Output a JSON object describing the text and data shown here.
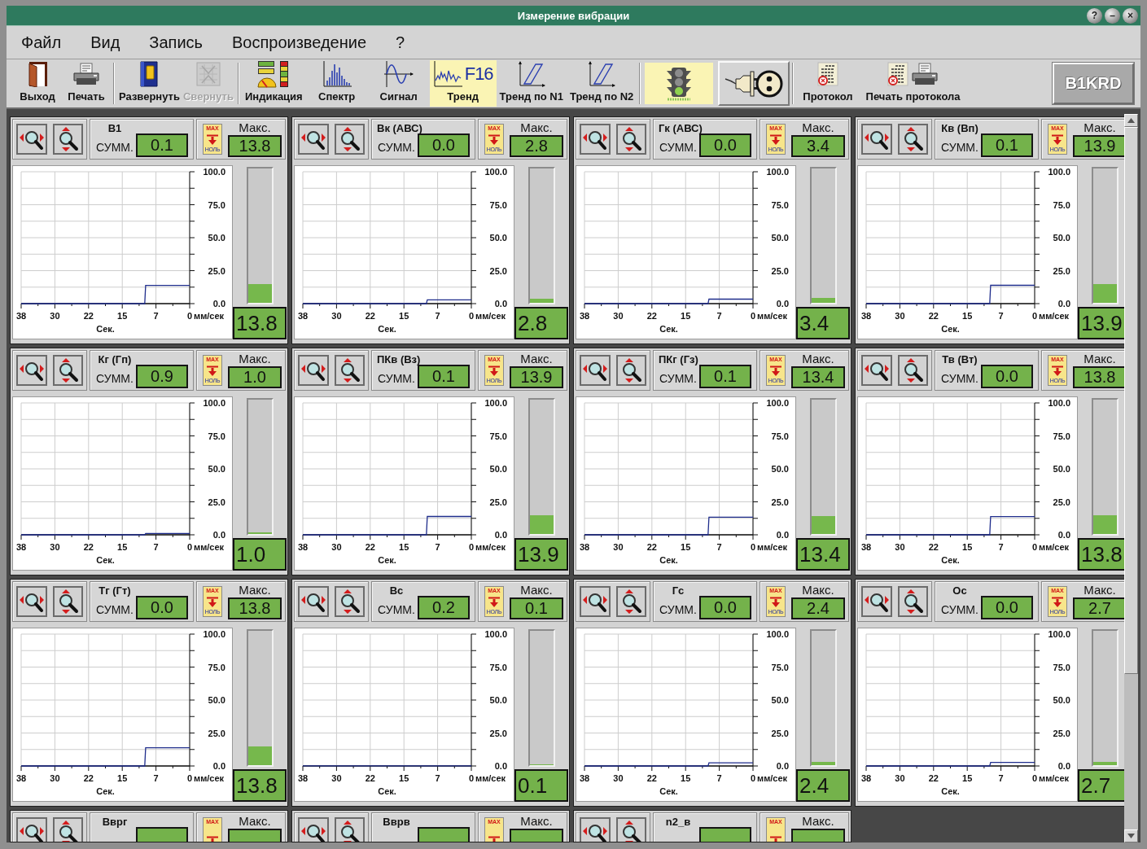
{
  "window": {
    "title": "Измерение вибрации",
    "controls": [
      "?",
      "–",
      "×"
    ]
  },
  "menu": [
    "Файл",
    "Вид",
    "Запись",
    "Воспроизведение",
    "?"
  ],
  "toolbar": {
    "groups": [
      {
        "buttons": [
          {
            "kind": "tool",
            "label": "Выход",
            "selected": false,
            "disabled": false
          },
          {
            "kind": "tool",
            "label": "Печать",
            "selected": false,
            "disabled": false
          }
        ]
      },
      {
        "buttons": [
          {
            "kind": "tool",
            "label": "Развернуть",
            "selected": false,
            "disabled": false
          },
          {
            "kind": "tool",
            "label": "Свернуть",
            "selected": false,
            "disabled": true
          }
        ]
      },
      {
        "buttons": [
          {
            "kind": "tool",
            "label": "Индикация",
            "selected": false,
            "disabled": false
          },
          {
            "kind": "tool",
            "label": "Спектр",
            "selected": false,
            "disabled": false
          },
          {
            "kind": "tool",
            "label": "Сигнал",
            "selected": false,
            "disabled": false
          },
          {
            "kind": "tool",
            "label": "Тренд",
            "badge": "F16",
            "selected": true,
            "disabled": false
          },
          {
            "kind": "tool",
            "label": "Тренд по N1",
            "selected": false,
            "disabled": false
          },
          {
            "kind": "tool",
            "label": "Тренд по N2",
            "selected": false,
            "disabled": false
          }
        ]
      },
      {
        "buttons": [
          {
            "kind": "icon",
            "selected": true,
            "disabled": false
          },
          {
            "kind": "icon",
            "selected": false,
            "disabled": false
          }
        ]
      },
      {
        "buttons": [
          {
            "kind": "tool",
            "label": "Протокол",
            "selected": false,
            "disabled": false
          },
          {
            "kind": "tool",
            "label": "Печать протокола",
            "selected": false,
            "disabled": false
          }
        ]
      }
    ],
    "device_button": {
      "label": "B1KRD"
    }
  },
  "panels": [
    {
      "name": "В1",
      "sum_label": "СУММ.",
      "sum": "0.1",
      "reset_button": {
        "top": "MAX",
        "bottom": "НОЛЬ"
      },
      "max_label": "Макс.",
      "max": "13.8",
      "level": 0.138,
      "reading": "13.8",
      "chart_data": {
        "type": "line",
        "xlabel": "Сек.",
        "ylabel": "мм/сек",
        "x": [
          37.5,
          10,
          9.8,
          0
        ],
        "series": [
          {
            "color": "#1f2d8c",
            "values": [
              0,
              0,
              13.8,
              13.8
            ]
          }
        ],
        "xlim": [
          37.5,
          0
        ],
        "ylim": [
          0,
          100
        ],
        "xticks": [
          {
            "value": 37.5,
            "label": "38"
          },
          30,
          {
            "value": 22.5,
            "label": "22"
          },
          15,
          {
            "value": 7.5,
            "label": "7"
          },
          0
        ],
        "yticks": [
          {
            "value": 0,
            "label": "0.0"
          },
          {
            "value": 25,
            "label": "25.0"
          },
          {
            "value": 50,
            "label": "50.0"
          },
          {
            "value": 75,
            "label": "75.0"
          },
          {
            "value": 100,
            "label": "100.0"
          }
        ],
        "grid": true
      }
    },
    {
      "name": "Вк (АВС)",
      "sum_label": "СУММ.",
      "sum": "0.0",
      "reset_button": {
        "top": "MAX",
        "bottom": "НОЛЬ"
      },
      "max_label": "Макс.",
      "max": "2.8",
      "level": 0.028,
      "reading": "2.8",
      "chart_data": {
        "type": "line",
        "xlabel": "Сек.",
        "ylabel": "мм/сек",
        "x": [
          37.5,
          10,
          9.8,
          0
        ],
        "series": [
          {
            "color": "#1f2d8c",
            "values": [
              0,
              0,
              2.8,
              2.8
            ]
          }
        ],
        "xlim": [
          37.5,
          0
        ],
        "ylim": [
          0,
          100
        ],
        "xticks": [
          {
            "value": 37.5,
            "label": "38"
          },
          30,
          {
            "value": 22.5,
            "label": "22"
          },
          15,
          {
            "value": 7.5,
            "label": "7"
          },
          0
        ],
        "yticks": [
          {
            "value": 0,
            "label": "0.0"
          },
          {
            "value": 25,
            "label": "25.0"
          },
          {
            "value": 50,
            "label": "50.0"
          },
          {
            "value": 75,
            "label": "75.0"
          },
          {
            "value": 100,
            "label": "100.0"
          }
        ],
        "grid": true
      }
    },
    {
      "name": "Гк (АВС)",
      "sum_label": "СУММ.",
      "sum": "0.0",
      "reset_button": {
        "top": "MAX",
        "bottom": "НОЛЬ"
      },
      "max_label": "Макс.",
      "max": "3.4",
      "level": 0.034,
      "reading": "3.4",
      "chart_data": {
        "type": "line",
        "xlabel": "Сек.",
        "ylabel": "мм/сек",
        "x": [
          37.5,
          10,
          9.8,
          0
        ],
        "series": [
          {
            "color": "#1f2d8c",
            "values": [
              0,
              0,
              3.4,
              3.4
            ]
          }
        ],
        "xlim": [
          37.5,
          0
        ],
        "ylim": [
          0,
          100
        ],
        "xticks": [
          {
            "value": 37.5,
            "label": "38"
          },
          30,
          {
            "value": 22.5,
            "label": "22"
          },
          15,
          {
            "value": 7.5,
            "label": "7"
          },
          0
        ],
        "yticks": [
          {
            "value": 0,
            "label": "0.0"
          },
          {
            "value": 25,
            "label": "25.0"
          },
          {
            "value": 50,
            "label": "50.0"
          },
          {
            "value": 75,
            "label": "75.0"
          },
          {
            "value": 100,
            "label": "100.0"
          }
        ],
        "grid": true
      }
    },
    {
      "name": "Кв (Вп)",
      "sum_label": "СУММ.",
      "sum": "0.1",
      "reset_button": {
        "top": "MAX",
        "bottom": "НОЛЬ"
      },
      "max_label": "Макс.",
      "max": "13.9",
      "level": 0.139,
      "reading": "13.9",
      "chart_data": {
        "type": "line",
        "xlabel": "Сек.",
        "ylabel": "мм/сек",
        "x": [
          37.5,
          10,
          9.8,
          0
        ],
        "series": [
          {
            "color": "#1f2d8c",
            "values": [
              0,
              0,
              13.9,
              13.9
            ]
          }
        ],
        "xlim": [
          37.5,
          0
        ],
        "ylim": [
          0,
          100
        ],
        "xticks": [
          {
            "value": 37.5,
            "label": "38"
          },
          30,
          {
            "value": 22.5,
            "label": "22"
          },
          15,
          {
            "value": 7.5,
            "label": "7"
          },
          0
        ],
        "yticks": [
          {
            "value": 0,
            "label": "0.0"
          },
          {
            "value": 25,
            "label": "25.0"
          },
          {
            "value": 50,
            "label": "50.0"
          },
          {
            "value": 75,
            "label": "75.0"
          },
          {
            "value": 100,
            "label": "100.0"
          }
        ],
        "grid": true
      }
    },
    {
      "name": "Кг (Гп)",
      "sum_label": "СУММ.",
      "sum": "0.9",
      "reset_button": {
        "top": "MAX",
        "bottom": "НОЛЬ"
      },
      "max_label": "Макс.",
      "max": "1.0",
      "level": 0.01,
      "reading": "1.0",
      "chart_data": {
        "type": "line",
        "xlabel": "Сек.",
        "ylabel": "мм/сек",
        "x": [
          37.5,
          10,
          9.8,
          0
        ],
        "series": [
          {
            "color": "#1f2d8c",
            "values": [
              0,
              0,
              1.0,
              1.0
            ]
          }
        ],
        "xlim": [
          37.5,
          0
        ],
        "ylim": [
          0,
          100
        ],
        "xticks": [
          {
            "value": 37.5,
            "label": "38"
          },
          30,
          {
            "value": 22.5,
            "label": "22"
          },
          15,
          {
            "value": 7.5,
            "label": "7"
          },
          0
        ],
        "yticks": [
          {
            "value": 0,
            "label": "0.0"
          },
          {
            "value": 25,
            "label": "25.0"
          },
          {
            "value": 50,
            "label": "50.0"
          },
          {
            "value": 75,
            "label": "75.0"
          },
          {
            "value": 100,
            "label": "100.0"
          }
        ],
        "grid": true
      }
    },
    {
      "name": "ПКв (Вз)",
      "sum_label": "СУММ.",
      "sum": "0.1",
      "reset_button": {
        "top": "MAX",
        "bottom": "НОЛЬ"
      },
      "max_label": "Макс.",
      "max": "13.9",
      "level": 0.139,
      "reading": "13.9",
      "chart_data": {
        "type": "line",
        "xlabel": "Сек.",
        "ylabel": "мм/сек",
        "x": [
          37.5,
          10,
          9.8,
          0
        ],
        "series": [
          {
            "color": "#1f2d8c",
            "values": [
              0,
              0,
              13.9,
              13.9
            ]
          }
        ],
        "xlim": [
          37.5,
          0
        ],
        "ylim": [
          0,
          100
        ],
        "xticks": [
          {
            "value": 37.5,
            "label": "38"
          },
          30,
          {
            "value": 22.5,
            "label": "22"
          },
          15,
          {
            "value": 7.5,
            "label": "7"
          },
          0
        ],
        "yticks": [
          {
            "value": 0,
            "label": "0.0"
          },
          {
            "value": 25,
            "label": "25.0"
          },
          {
            "value": 50,
            "label": "50.0"
          },
          {
            "value": 75,
            "label": "75.0"
          },
          {
            "value": 100,
            "label": "100.0"
          }
        ],
        "grid": true
      }
    },
    {
      "name": "ПКг (Гз)",
      "sum_label": "СУММ.",
      "sum": "0.1",
      "reset_button": {
        "top": "MAX",
        "bottom": "НОЛЬ"
      },
      "max_label": "Макс.",
      "max": "13.4",
      "level": 0.134,
      "reading": "13.4",
      "chart_data": {
        "type": "line",
        "xlabel": "Сек.",
        "ylabel": "мм/сек",
        "x": [
          37.5,
          10,
          9.8,
          0
        ],
        "series": [
          {
            "color": "#1f2d8c",
            "values": [
              0,
              0,
              13.4,
              13.4
            ]
          }
        ],
        "xlim": [
          37.5,
          0
        ],
        "ylim": [
          0,
          100
        ],
        "xticks": [
          {
            "value": 37.5,
            "label": "38"
          },
          30,
          {
            "value": 22.5,
            "label": "22"
          },
          15,
          {
            "value": 7.5,
            "label": "7"
          },
          0
        ],
        "yticks": [
          {
            "value": 0,
            "label": "0.0"
          },
          {
            "value": 25,
            "label": "25.0"
          },
          {
            "value": 50,
            "label": "50.0"
          },
          {
            "value": 75,
            "label": "75.0"
          },
          {
            "value": 100,
            "label": "100.0"
          }
        ],
        "grid": true
      }
    },
    {
      "name": "Тв (Вт)",
      "sum_label": "СУММ.",
      "sum": "0.0",
      "reset_button": {
        "top": "MAX",
        "bottom": "НОЛЬ"
      },
      "max_label": "Макс.",
      "max": "13.8",
      "level": 0.138,
      "reading": "13.8",
      "chart_data": {
        "type": "line",
        "xlabel": "Сек.",
        "ylabel": "мм/сек",
        "x": [
          37.5,
          10,
          9.8,
          0
        ],
        "series": [
          {
            "color": "#1f2d8c",
            "values": [
              0,
              0,
              13.8,
              13.8
            ]
          }
        ],
        "xlim": [
          37.5,
          0
        ],
        "ylim": [
          0,
          100
        ],
        "xticks": [
          {
            "value": 37.5,
            "label": "38"
          },
          30,
          {
            "value": 22.5,
            "label": "22"
          },
          15,
          {
            "value": 7.5,
            "label": "7"
          },
          0
        ],
        "yticks": [
          {
            "value": 0,
            "label": "0.0"
          },
          {
            "value": 25,
            "label": "25.0"
          },
          {
            "value": 50,
            "label": "50.0"
          },
          {
            "value": 75,
            "label": "75.0"
          },
          {
            "value": 100,
            "label": "100.0"
          }
        ],
        "grid": true
      }
    },
    {
      "name": "Тг (Гт)",
      "sum_label": "СУММ.",
      "sum": "0.0",
      "reset_button": {
        "top": "MAX",
        "bottom": "НОЛЬ"
      },
      "max_label": "Макс.",
      "max": "13.8",
      "level": 0.138,
      "reading": "13.8",
      "chart_data": {
        "type": "line",
        "xlabel": "Сек.",
        "ylabel": "мм/сек",
        "x": [
          37.5,
          10,
          9.8,
          0
        ],
        "series": [
          {
            "color": "#1f2d8c",
            "values": [
              0,
              0,
              13.8,
              13.8
            ]
          }
        ],
        "xlim": [
          37.5,
          0
        ],
        "ylim": [
          0,
          100
        ],
        "xticks": [
          {
            "value": 37.5,
            "label": "38"
          },
          30,
          {
            "value": 22.5,
            "label": "22"
          },
          15,
          {
            "value": 7.5,
            "label": "7"
          },
          0
        ],
        "yticks": [
          {
            "value": 0,
            "label": "0.0"
          },
          {
            "value": 25,
            "label": "25.0"
          },
          {
            "value": 50,
            "label": "50.0"
          },
          {
            "value": 75,
            "label": "75.0"
          },
          {
            "value": 100,
            "label": "100.0"
          }
        ],
        "grid": true
      }
    },
    {
      "name": "Вс",
      "sum_label": "СУММ.",
      "sum": "0.2",
      "reset_button": {
        "top": "MAX",
        "bottom": "НОЛЬ"
      },
      "max_label": "Макс.",
      "max": "0.1",
      "level": 0.001,
      "reading": "0.1",
      "chart_data": {
        "type": "line",
        "xlabel": "Сек.",
        "ylabel": "мм/сек",
        "x": [
          37.5,
          0
        ],
        "series": [
          {
            "color": "#1f2d8c",
            "values": [
              0.1,
              0.1
            ]
          }
        ],
        "xlim": [
          37.5,
          0
        ],
        "ylim": [
          0,
          100
        ],
        "xticks": [
          {
            "value": 37.5,
            "label": "38"
          },
          30,
          {
            "value": 22.5,
            "label": "22"
          },
          15,
          {
            "value": 7.5,
            "label": "7"
          },
          0
        ],
        "yticks": [
          {
            "value": 0,
            "label": "0.0"
          },
          {
            "value": 25,
            "label": "25.0"
          },
          {
            "value": 50,
            "label": "50.0"
          },
          {
            "value": 75,
            "label": "75.0"
          },
          {
            "value": 100,
            "label": "100.0"
          }
        ],
        "grid": true
      }
    },
    {
      "name": "Гс",
      "sum_label": "СУММ.",
      "sum": "0.0",
      "reset_button": {
        "top": "MAX",
        "bottom": "НОЛЬ"
      },
      "max_label": "Макс.",
      "max": "2.4",
      "level": 0.024,
      "reading": "2.4",
      "chart_data": {
        "type": "line",
        "xlabel": "Сек.",
        "ylabel": "мм/сек",
        "x": [
          37.5,
          10,
          9.8,
          0
        ],
        "series": [
          {
            "color": "#1f2d8c",
            "values": [
              0,
              0,
              2.4,
              2.4
            ]
          }
        ],
        "xlim": [
          37.5,
          0
        ],
        "ylim": [
          0,
          100
        ],
        "xticks": [
          {
            "value": 37.5,
            "label": "38"
          },
          30,
          {
            "value": 22.5,
            "label": "22"
          },
          15,
          {
            "value": 7.5,
            "label": "7"
          },
          0
        ],
        "yticks": [
          {
            "value": 0,
            "label": "0.0"
          },
          {
            "value": 25,
            "label": "25.0"
          },
          {
            "value": 50,
            "label": "50.0"
          },
          {
            "value": 75,
            "label": "75.0"
          },
          {
            "value": 100,
            "label": "100.0"
          }
        ],
        "grid": true
      }
    },
    {
      "name": "Ос",
      "sum_label": "СУММ.",
      "sum": "0.0",
      "reset_button": {
        "top": "MAX",
        "bottom": "НОЛЬ"
      },
      "max_label": "Макс.",
      "max": "2.7",
      "level": 0.027,
      "reading": "2.7",
      "chart_data": {
        "type": "line",
        "xlabel": "Сек.",
        "ylabel": "мм/сек",
        "x": [
          37.5,
          10,
          9.8,
          0
        ],
        "series": [
          {
            "color": "#1f2d8c",
            "values": [
              0,
              0,
              2.7,
              2.7
            ]
          }
        ],
        "xlim": [
          37.5,
          0
        ],
        "ylim": [
          0,
          100
        ],
        "xticks": [
          {
            "value": 37.5,
            "label": "38"
          },
          30,
          {
            "value": 22.5,
            "label": "22"
          },
          15,
          {
            "value": 7.5,
            "label": "7"
          },
          0
        ],
        "yticks": [
          {
            "value": 0,
            "label": "0.0"
          },
          {
            "value": 25,
            "label": "25.0"
          },
          {
            "value": 50,
            "label": "50.0"
          },
          {
            "value": 75,
            "label": "75.0"
          },
          {
            "value": 100,
            "label": "100.0"
          }
        ],
        "grid": true
      }
    },
    {
      "name": "Вврг",
      "reset_button": {
        "top": "MAX"
      },
      "max_label": "Макс."
    },
    {
      "name": "Вврв",
      "reset_button": {
        "top": "MAX"
      },
      "max_label": "Макс."
    },
    {
      "name": "n2_в",
      "reset_button": {
        "top": "MAX"
      },
      "max_label": "Макс."
    }
  ]
}
